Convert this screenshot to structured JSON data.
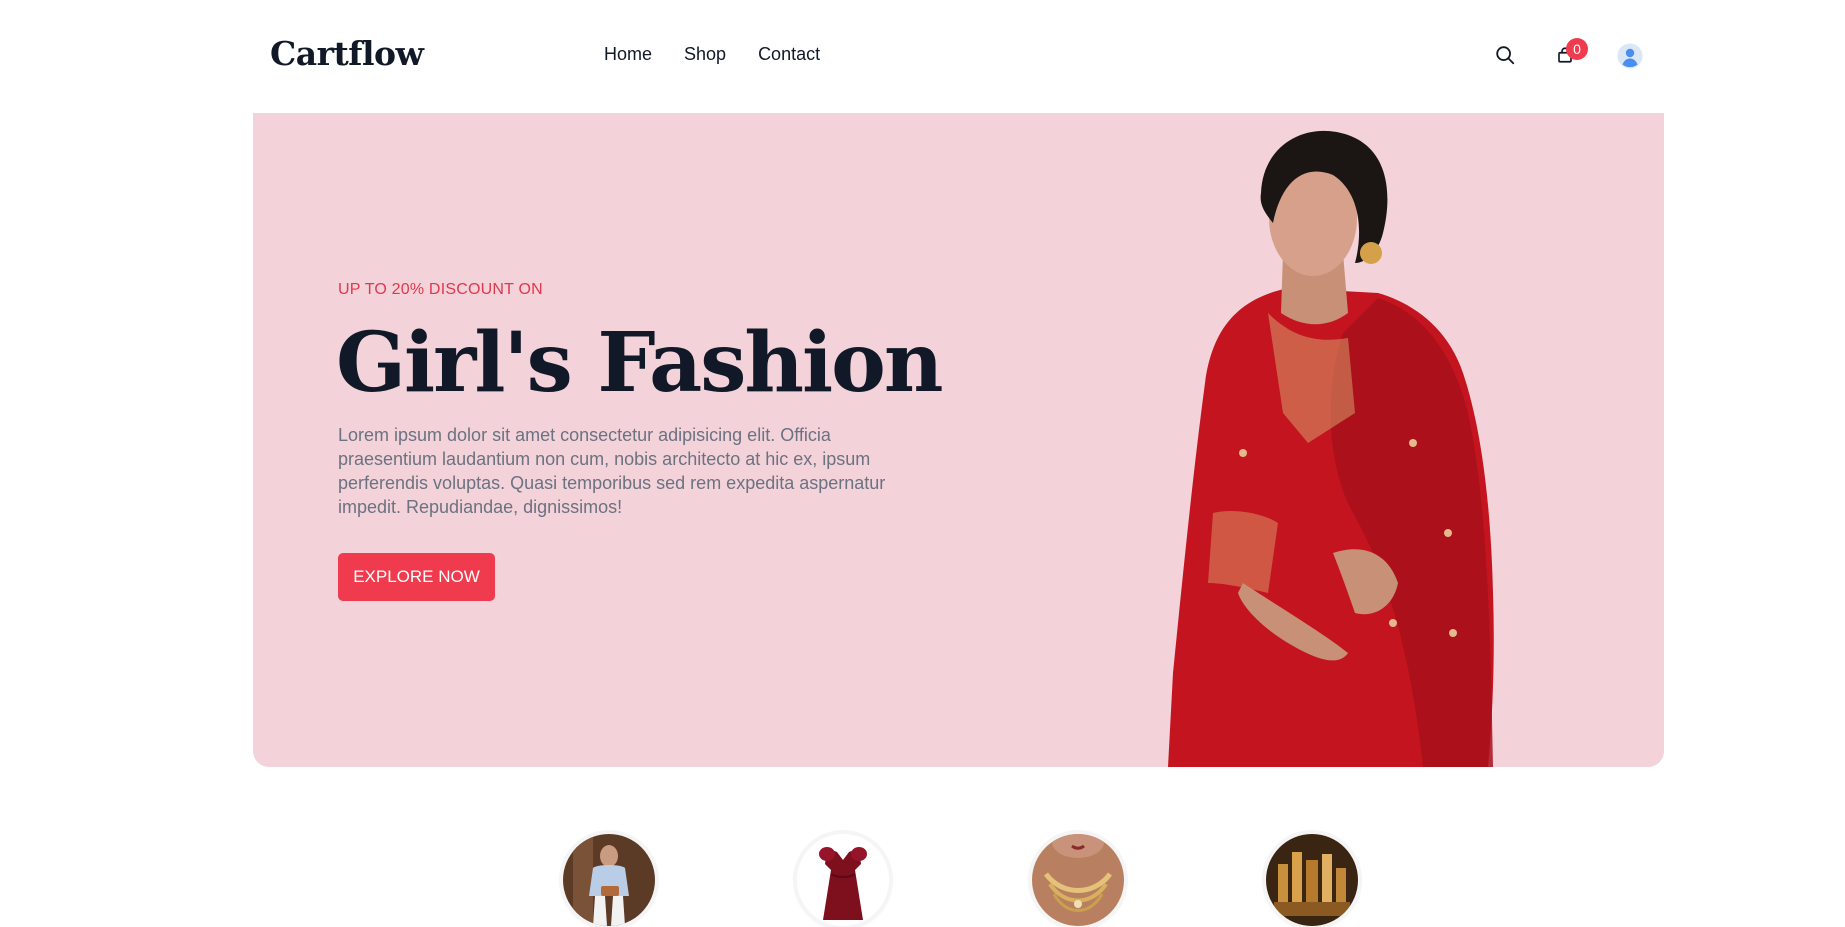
{
  "brand": {
    "name": "Cartflow"
  },
  "nav": {
    "items": [
      "Home",
      "Shop",
      "Contact"
    ]
  },
  "header": {
    "cart_count": "0"
  },
  "hero": {
    "eyebrow": "UP TO 20% DISCOUNT ON",
    "title": "Girl's Fashion",
    "description": "Lorem ipsum dolor sit amet consectetur adipisicing elit. Officia praesentium laudantium non cum, nobis architecto at hic ex, ipsum perferendis voluptas. Quasi temporibus sed rem expedita aspernatur impedit. Repudiandae, dignissimos!",
    "cta_label": "EXPLORE NOW"
  },
  "colors": {
    "accent": "#ef3b4d",
    "hero_bg": "#f3d2d9",
    "text_dark": "#111827",
    "text_muted": "#6b7280"
  },
  "categories": [
    {
      "icon": "casual-wear-icon"
    },
    {
      "icon": "dress-icon"
    },
    {
      "icon": "jewelry-icon"
    },
    {
      "icon": "cosmetics-icon"
    }
  ]
}
